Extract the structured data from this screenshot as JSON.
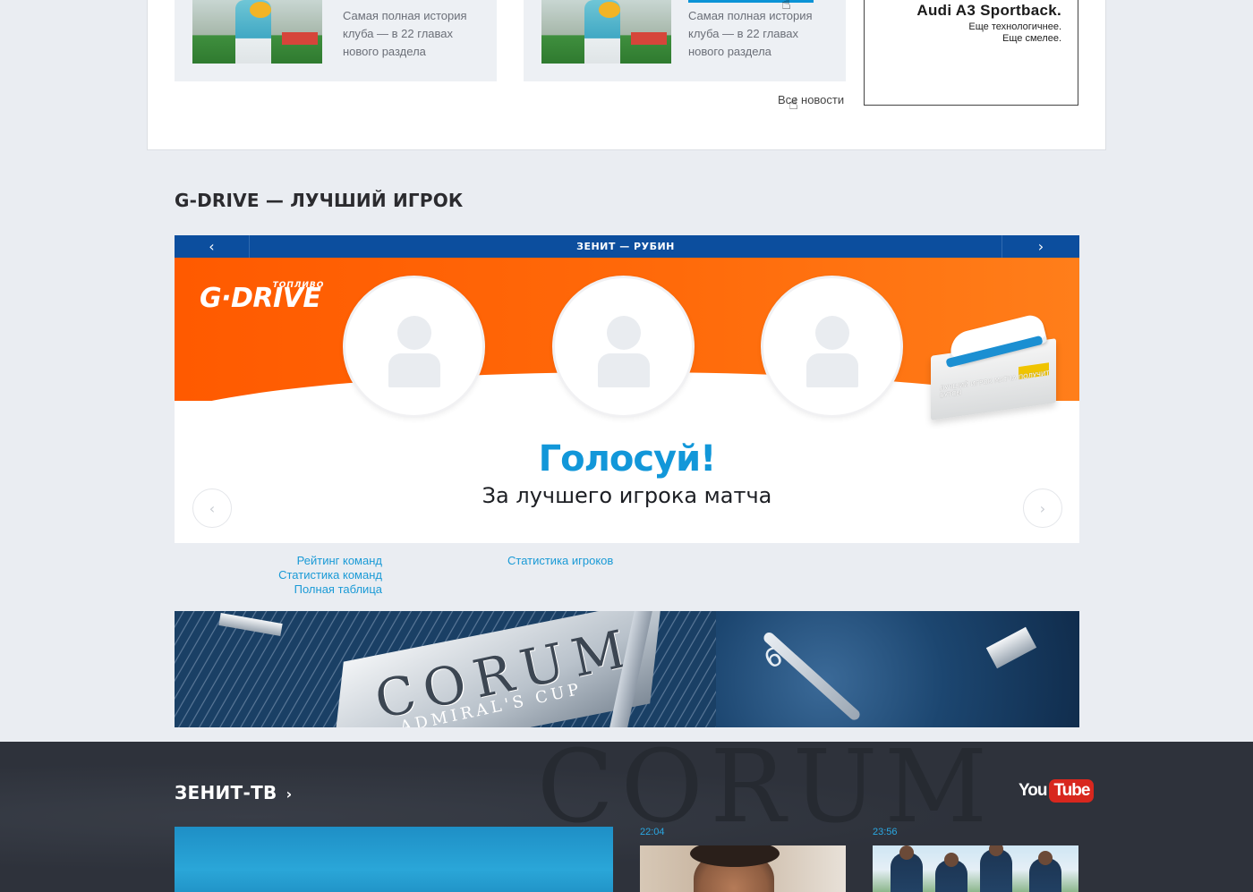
{
  "news": {
    "cards": [
      {
        "text": "Самая полная история клуба — в 22 главах нового раздела"
      },
      {
        "text": "Самая полная история клуба — в 22 главах нового раздела"
      }
    ],
    "all_news_label": "Все новости"
  },
  "ad_audi": {
    "title": "Audi A3 Sportback.",
    "line1": "Еще технологичнее.",
    "line2": "Еще смелее."
  },
  "gdrive": {
    "section_title": "G-DRIVE — ЛУЧШИЙ ИГРОК",
    "match": "ЗЕНИТ — РУБИН",
    "logo_text": "G·DRIVE",
    "logo_small": "ТОПЛИВО",
    "vote_title": "Голосуй!",
    "vote_subtitle": "За лучшего игрока матча",
    "prize_text": "ЛУЧШИЙ ИГРОК МАТЧА ПОЛУЧИТ БУТСЫ"
  },
  "stats": {
    "left_links": [
      "Рейтинг команд",
      "Статистика команд",
      "Полная таблица"
    ],
    "right_links": [
      "Статистика игроков"
    ]
  },
  "corum_banner": {
    "brand": "CORUM",
    "subline": "ADMIRAL'S CUP"
  },
  "tv": {
    "title": "ЗЕНИТ-ТВ",
    "youtube_you": "You",
    "youtube_tube": "Tube",
    "watermark": "CORUM",
    "videos": [
      {
        "time": "22:04"
      },
      {
        "time": "23:56"
      }
    ]
  },
  "colors": {
    "accent_blue": "#1297d9",
    "match_bar": "#0c4e9e",
    "gdrive_orange": "#ff6a0a",
    "tv_background": "#2e323b",
    "youtube_red": "#d8271e"
  }
}
